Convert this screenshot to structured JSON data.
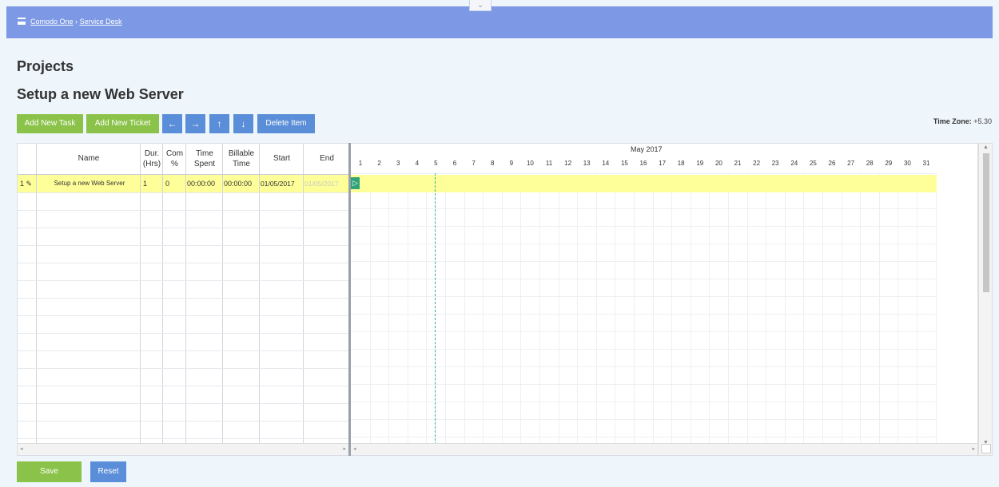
{
  "breadcrumb": {
    "root": "Comodo One",
    "sep": "›",
    "current": "Service Desk"
  },
  "collapse_glyph": "⌄",
  "page_title": "Projects",
  "project_title": "Setup a new Web Server",
  "toolbar": {
    "add_task": "Add New Task",
    "add_ticket": "Add New Ticket",
    "left": "←",
    "right": "→",
    "up": "↑",
    "down": "↓",
    "delete": "Delete Item"
  },
  "timezone": {
    "label": "Time Zone:",
    "value": "+5.30"
  },
  "grid": {
    "headers": {
      "name": "Name",
      "dur": "Dur. (Hrs)",
      "com": "Com %",
      "time_spent": "Time Spent",
      "billable": "Billable Time",
      "start": "Start",
      "end": "End"
    },
    "rows": [
      {
        "index": "1",
        "name": "Setup a new Web Server",
        "dur": "1",
        "com": "0",
        "time_spent": "00:00:00",
        "billable": "00:00:00",
        "start": "01/05/2017",
        "end": "01/05/2017"
      }
    ]
  },
  "gantt": {
    "month": "May 2017",
    "days": [
      "1",
      "2",
      "3",
      "4",
      "5",
      "6",
      "7",
      "8",
      "9",
      "10",
      "11",
      "12",
      "13",
      "14",
      "15",
      "16",
      "17",
      "18",
      "19",
      "20",
      "21",
      "22",
      "23",
      "24",
      "25",
      "26",
      "27",
      "28",
      "29",
      "30",
      "31"
    ],
    "handle": "▷"
  },
  "footer": {
    "save": "Save",
    "reset": "Reset"
  },
  "colors": {
    "topbar": "#7d98e4",
    "green": "#8bc34a",
    "blue": "#5b8ed8",
    "task_row": "#ffff99",
    "today_line": "#2ab39a"
  },
  "icons": [
    "menu-icon",
    "arrow-left-icon",
    "arrow-right-icon",
    "arrow-up-icon",
    "arrow-down-icon",
    "edit-icon"
  ]
}
